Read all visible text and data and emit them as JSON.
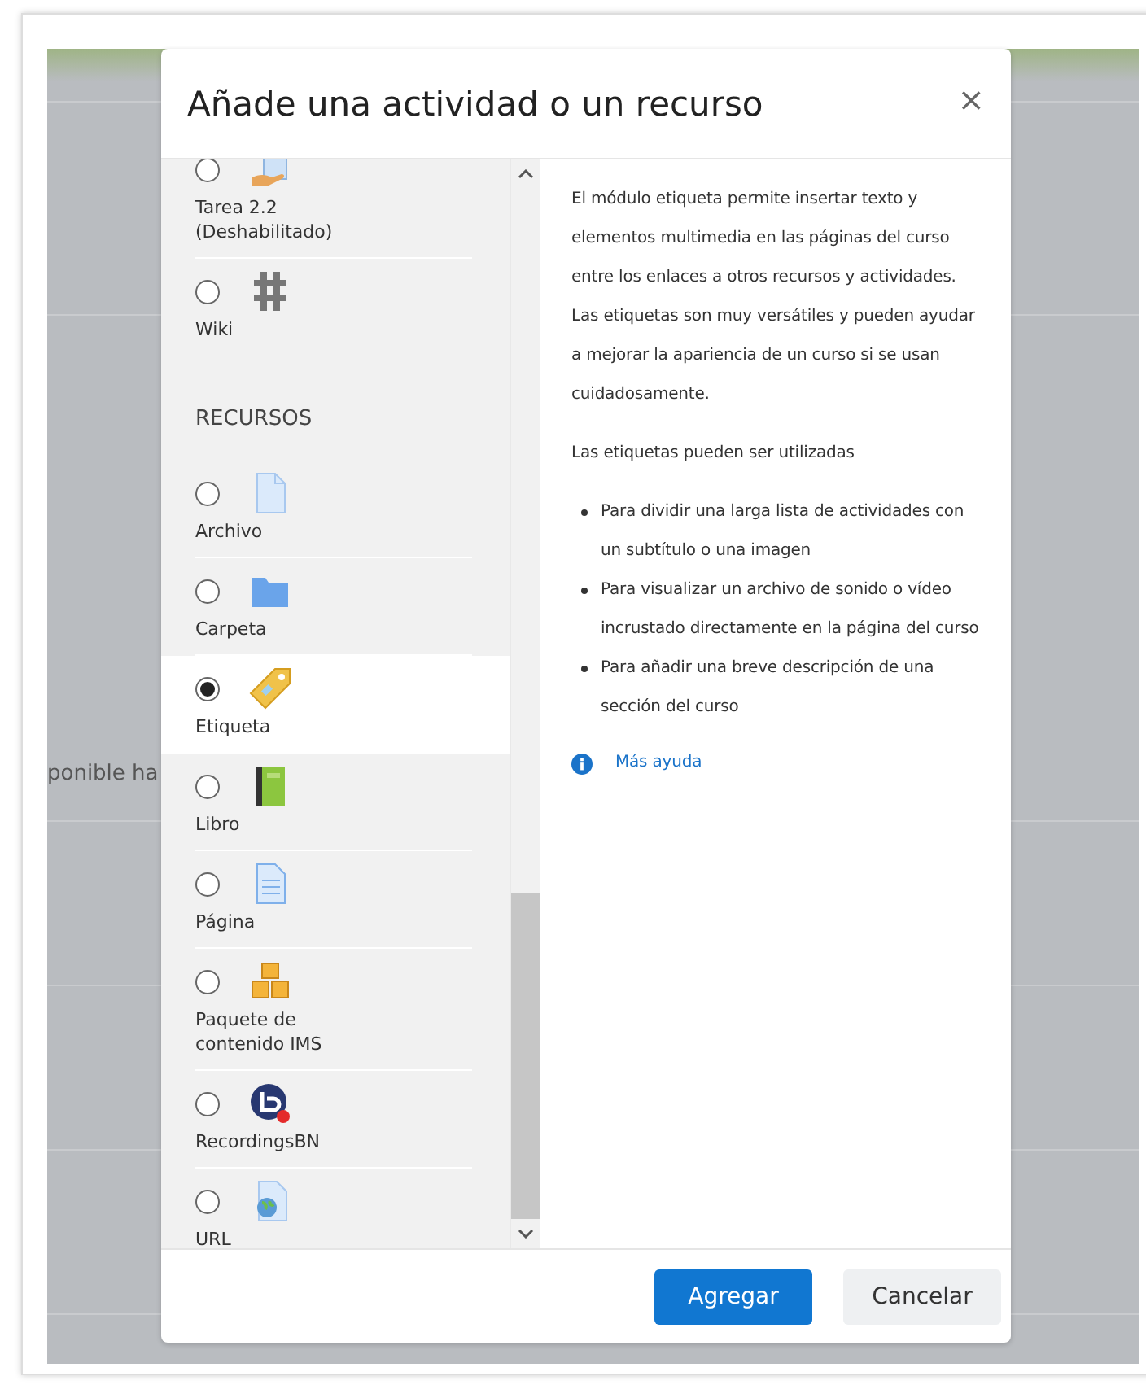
{
  "background": {
    "text_fragment": "ponible ha"
  },
  "dialog": {
    "title": "Añade una actividad o un recurso",
    "close": "×",
    "sections": [
      {
        "items": [
          {
            "label": "Tarea 2.2 (Deshabilitado)",
            "kind": "assign",
            "selected": false
          },
          {
            "label": "Wiki",
            "kind": "wiki",
            "selected": false
          }
        ]
      },
      {
        "heading": "RECURSOS",
        "items": [
          {
            "label": "Archivo",
            "kind": "file",
            "selected": false
          },
          {
            "label": "Carpeta",
            "kind": "folder",
            "selected": false
          },
          {
            "label": "Etiqueta",
            "kind": "label",
            "selected": true
          },
          {
            "label": "Libro",
            "kind": "book",
            "selected": false
          },
          {
            "label": "Página",
            "kind": "page",
            "selected": false
          },
          {
            "label": "Paquete de contenido IMS",
            "kind": "package",
            "selected": false
          },
          {
            "label": "RecordingsBN",
            "kind": "recordings",
            "selected": false
          },
          {
            "label": "URL",
            "kind": "url",
            "selected": false
          }
        ]
      }
    ],
    "help": {
      "paragraphs": [
        "El módulo etiqueta permite insertar texto y elementos multimedia en las páginas del curso entre los enlaces a otros recursos y actividades. Las etiquetas son muy versátiles y pueden ayudar a mejorar la apariencia de un curso si se usan cuidadosamente.",
        "Las etiquetas pueden ser utilizadas"
      ],
      "bullets": [
        "Para dividir una larga lista de actividades con un subtítulo o una imagen",
        "Para visualizar un archivo de sonido o vídeo incrustado directamente en la página del curso",
        "Para añadir una breve descripción de una sección del curso"
      ],
      "link": "Más ayuda"
    },
    "buttons": [
      {
        "label": "Agregar",
        "kind": "primary"
      },
      {
        "label": "Cancelar",
        "kind": "secondary"
      }
    ]
  }
}
